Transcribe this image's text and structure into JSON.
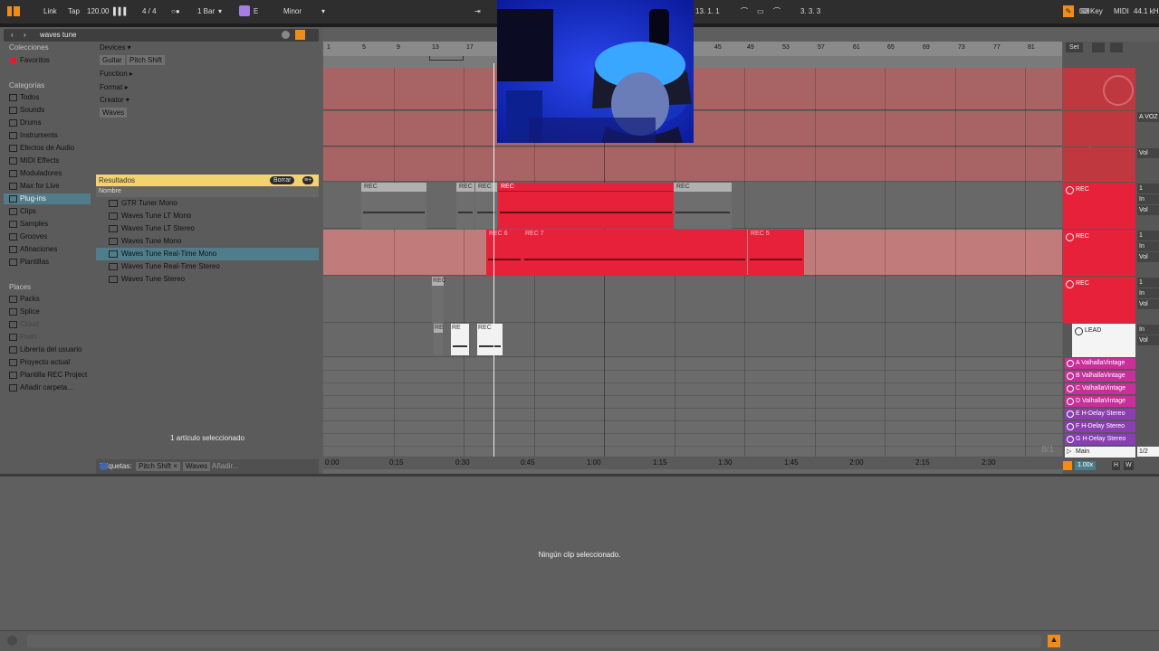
{
  "transport": {
    "link": "Link",
    "tap": "Tap",
    "tempo": "120.00",
    "signature_num": "4",
    "signature_den": "4",
    "quantize": "1 Bar",
    "key": "E",
    "scale": "Minor",
    "position": "13. 1. 1",
    "loop_length": "3. 3. 3",
    "key_btn": "Key",
    "midi_btn": "MIDI",
    "sample_rate": "44.1 kH"
  },
  "browser": {
    "search": "waves tune",
    "collections_heading": "Colecciones",
    "favorites": "Favoritos",
    "categories_heading": "Categorías",
    "categories": [
      "Todos",
      "Sounds",
      "Drums",
      "Instruments",
      "Efectos de Audio",
      "MIDI Effects",
      "Moduladores",
      "Max for Live",
      "Plug-ins",
      "Clips",
      "Samples",
      "Grooves",
      "Afinaciones",
      "Plantillas"
    ],
    "places_heading": "Places",
    "places": [
      "Packs",
      "Splice",
      "Cloud",
      "Push",
      "Librería del usuario",
      "Proyecto actual",
      "Plantilla REC Project",
      "Añadir carpeta..."
    ],
    "filters": {
      "devices": "Devices",
      "guitar": "Guitar",
      "pitch_shift": "Pitch Shift",
      "function": "Function",
      "format": "Format",
      "creator": "Creator",
      "waves": "Waves"
    },
    "results_label": "Resultados",
    "clear_btn": "Borrar",
    "name_col": "Nombre",
    "results": [
      "GTR Tuner Mono",
      "Waves Tune LT Mono",
      "Waves Tune LT Stereo",
      "Waves Tune Mono",
      "Waves Tune Real-Time Mono",
      "Waves Tune Real-Time Stereo",
      "Waves Tune Stereo"
    ],
    "tags_label": "Etiquetas:",
    "tag1": "Pitch Shift",
    "tag2": "Waves",
    "tag_add": "Añadir...",
    "selection_status": "1 artículo seleccionado"
  },
  "ruler": {
    "bars": [
      "1",
      "5",
      "9",
      "13",
      "17",
      "45",
      "49",
      "53",
      "57",
      "61",
      "65",
      "69",
      "73",
      "77",
      "81"
    ],
    "set_btn": "Set",
    "times": [
      "0:00",
      "0:15",
      "0:30",
      "0:45",
      "1:00",
      "1:15",
      "1:30",
      "1:45",
      "2:00",
      "2:15",
      "2:30"
    ]
  },
  "clips": {
    "rec": "REC",
    "rec6": "REC 6",
    "rec7": "REC 7",
    "rec5": "REC 5",
    "re": "RE"
  },
  "mixer": {
    "vol": "Vol",
    "a_voz": "A VOZ",
    "rec": "REC",
    "lead": "LEAD",
    "in": "In",
    "one": "1",
    "returns": [
      "A ValhallaVintage",
      "B ValhallaVintage",
      "C ValhallaVintage",
      "D ValhallaVintage",
      "E H-Delay Stereo",
      "F H-Delay Stereo",
      "G H-Delay Stereo"
    ],
    "main": "Main",
    "main_ratio": "1/2",
    "overview": "8/1",
    "zoom": "1.00x",
    "h": "H",
    "w": "W"
  },
  "detail": {
    "no_clip": "Ningún clip seleccionado."
  },
  "colors": {
    "accent": "#f08c1b",
    "rec_red": "#e8213b",
    "track_pink": "#a86464",
    "selection": "#4f7d8c",
    "results_bar": "#f2d36e",
    "return_magenta": "#c92e9a",
    "return_purple": "#8a3eb0"
  }
}
